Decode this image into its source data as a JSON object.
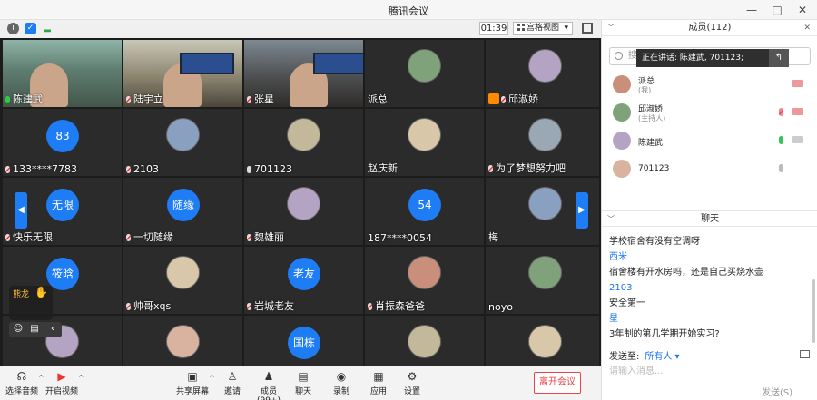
{
  "window": {
    "title": "腾讯会议",
    "minimize": "—",
    "maximize": "□",
    "close": "✕"
  },
  "top_toolbar": {
    "time": "01:39",
    "view_label": "宫格视图",
    "view_caret": "▾"
  },
  "tiles": [
    {
      "name": "陈建武",
      "type": "video",
      "mic": "speaking"
    },
    {
      "name": "陆宇立",
      "type": "video",
      "mic": "muted"
    },
    {
      "name": "张星",
      "type": "video",
      "mic": "muted"
    },
    {
      "name": "派总",
      "type": "avatar",
      "mic": "none"
    },
    {
      "name": "邱淑娇",
      "type": "avatar",
      "mic": "muted",
      "host": true
    },
    {
      "name": "133****7783",
      "type": "circle",
      "circle_text": "83",
      "mic": "muted"
    },
    {
      "name": "2103",
      "type": "avatar",
      "mic": "muted"
    },
    {
      "name": "701123",
      "type": "avatar",
      "mic": "on"
    },
    {
      "name": "赵庆新",
      "type": "avatar",
      "mic": "none"
    },
    {
      "name": "为了梦想努力吧",
      "type": "avatar",
      "mic": "muted"
    },
    {
      "name": "快乐无限",
      "type": "circle",
      "circle_text": "无限",
      "mic": "muted"
    },
    {
      "name": "一切随缘",
      "type": "circle",
      "circle_text": "随缘",
      "mic": "muted"
    },
    {
      "name": "魏雄丽",
      "type": "avatar",
      "mic": "muted"
    },
    {
      "name": "187****0054",
      "type": "circle",
      "circle_text": "54",
      "mic": "none"
    },
    {
      "name": "梅",
      "type": "avatar",
      "mic": "none"
    },
    {
      "name": "",
      "type": "circle",
      "circle_text": "筱晗",
      "mic": "none"
    },
    {
      "name": "帅哥xqs",
      "type": "avatar",
      "mic": "muted"
    },
    {
      "name": "岩城老友",
      "type": "circle",
      "circle_text": "老友",
      "mic": "muted"
    },
    {
      "name": "肖振森爸爸",
      "type": "avatar",
      "mic": "muted"
    },
    {
      "name": "noyo",
      "type": "avatar",
      "mic": "none"
    },
    {
      "name": "",
      "type": "avatar",
      "mic": "none"
    },
    {
      "name": "",
      "type": "avatar",
      "mic": "none"
    },
    {
      "name": "",
      "type": "circle",
      "circle_text": "国栋",
      "mic": "none"
    },
    {
      "name": "",
      "type": "avatar",
      "mic": "none"
    },
    {
      "name": "",
      "type": "avatar",
      "mic": "none"
    }
  ],
  "reaction_popup": {
    "name": "熊龙",
    "sub": ""
  },
  "page_arrows": {
    "left": "◀",
    "right": "▶"
  },
  "bottom_toolbar": {
    "audio": "选择音频",
    "video": "开启视频",
    "share": "共享屏幕",
    "invite": "邀请",
    "members": "成员(99+)",
    "chat": "聊天",
    "record": "录制",
    "apps": "应用",
    "settings": "设置",
    "leave": "离开会议"
  },
  "members_panel": {
    "title": "成员(112)",
    "search_placeholder": "搜索",
    "speaking_tooltip": "正在讲话: 陈建武, 701123;",
    "members": [
      {
        "name": "派总",
        "role": "(我)",
        "mic": "none",
        "cam": "on"
      },
      {
        "name": "邱淑娇",
        "role": "(主持人)",
        "mic": "muted",
        "cam": "on"
      },
      {
        "name": "陈建武",
        "role": "",
        "mic": "speaking",
        "cam": "off"
      },
      {
        "name": "701123",
        "role": "",
        "mic": "on",
        "cam": "none"
      }
    ]
  },
  "chat_panel": {
    "title": "聊天",
    "messages": [
      {
        "kind": "msg",
        "text": "学校宿舍有没有空调呀"
      },
      {
        "kind": "sender",
        "text": "西米"
      },
      {
        "kind": "msg",
        "text": "宿舍楼有开水房吗，还是自己买烧水壶"
      },
      {
        "kind": "sender",
        "text": "2103"
      },
      {
        "kind": "msg",
        "text": "安全第一"
      },
      {
        "kind": "sender",
        "text": "星"
      },
      {
        "kind": "msg",
        "text": "3年制的第几学期开始实习?"
      }
    ],
    "send_to_label": "发送至:",
    "send_to_target": "所有人 ▾",
    "input_placeholder": "请输入消息...",
    "send_button": "发送(S)"
  },
  "colors": {
    "accent": "#1e7cf5",
    "leave": "#e64545",
    "speaking": "#2ecc40"
  }
}
